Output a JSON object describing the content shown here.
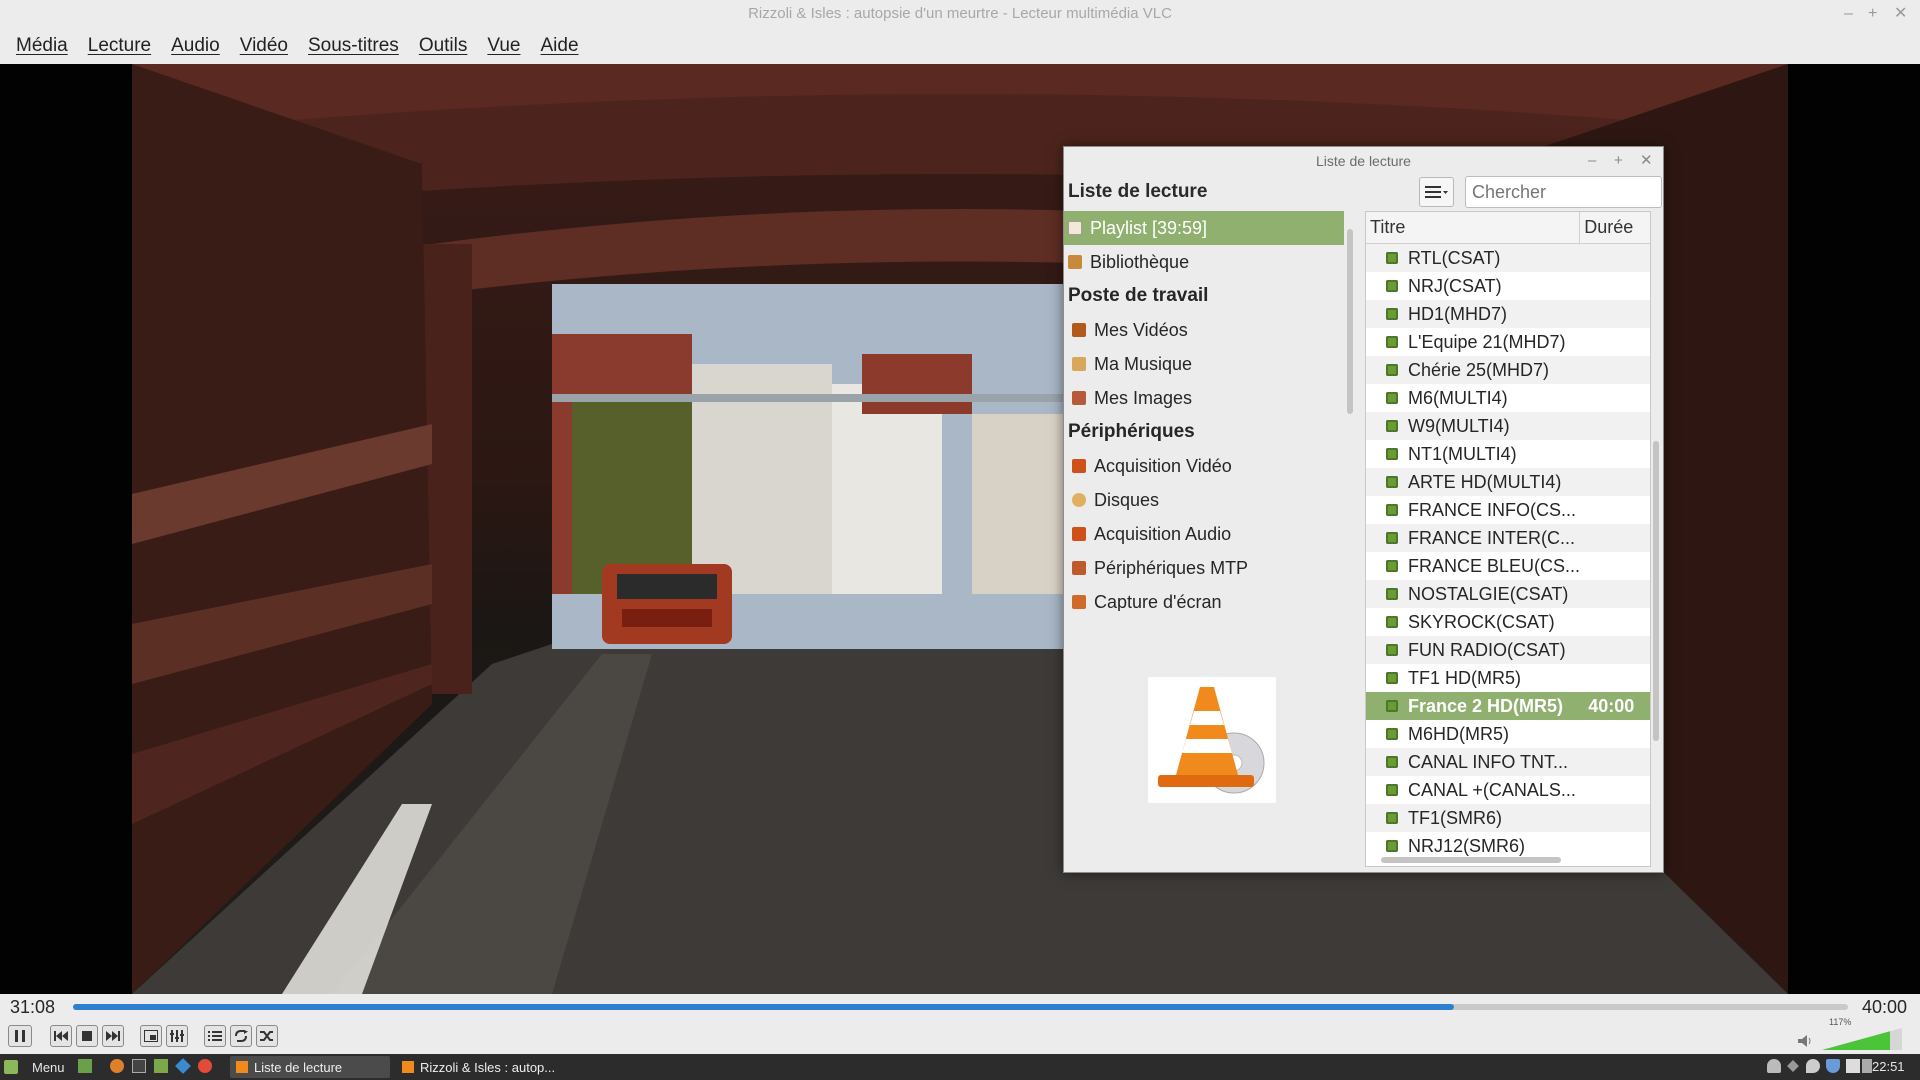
{
  "window": {
    "title": "Rizzoli & Isles : autopsie d'un meurtre - Lecteur multimédia VLC",
    "min_glyph": "–",
    "max_glyph": "+",
    "close_glyph": "✕"
  },
  "menu": [
    "Média",
    "Lecture",
    "Audio",
    "Vidéo",
    "Sous-titres",
    "Outils",
    "Vue",
    "Aide"
  ],
  "playlist_dialog": {
    "title": "Liste de lecture",
    "header": "Liste de lecture",
    "search_placeholder": "Chercher",
    "sidebar": {
      "playlist": "Playlist [39:59]",
      "library": "Bibliothèque",
      "cat_mycomputer": "Poste de travail",
      "my_videos": "Mes Vidéos",
      "my_music": "Ma Musique",
      "my_images": "Mes Images",
      "cat_devices": "Périphériques",
      "video_capture": "Acquisition Vidéo",
      "discs": "Disques",
      "audio_capture": "Acquisition Audio",
      "mtp_devices": "Périphériques MTP",
      "screen_capture": "Capture d'écran"
    },
    "columns": {
      "title": "Titre",
      "duration": "Durée"
    },
    "items": [
      {
        "title": "RTL(CSAT)",
        "duration": ""
      },
      {
        "title": "NRJ(CSAT)",
        "duration": ""
      },
      {
        "title": "HD1(MHD7)",
        "duration": ""
      },
      {
        "title": "L'Equipe 21(MHD7)",
        "duration": ""
      },
      {
        "title": "Chérie 25(MHD7)",
        "duration": ""
      },
      {
        "title": "M6(MULTI4)",
        "duration": ""
      },
      {
        "title": "W9(MULTI4)",
        "duration": ""
      },
      {
        "title": "NT1(MULTI4)",
        "duration": ""
      },
      {
        "title": "ARTE HD(MULTI4)",
        "duration": ""
      },
      {
        "title": "FRANCE INFO(CS...",
        "duration": ""
      },
      {
        "title": "FRANCE INTER(C...",
        "duration": ""
      },
      {
        "title": "FRANCE BLEU(CS...",
        "duration": ""
      },
      {
        "title": "NOSTALGIE(CSAT)",
        "duration": ""
      },
      {
        "title": "SKYROCK(CSAT)",
        "duration": ""
      },
      {
        "title": "FUN RADIO(CSAT)",
        "duration": ""
      },
      {
        "title": "TF1 HD(MR5)",
        "duration": ""
      },
      {
        "title": "France 2 HD(MR5)",
        "duration": "40:00"
      },
      {
        "title": "M6HD(MR5)",
        "duration": ""
      },
      {
        "title": "CANAL INFO TNT...",
        "duration": ""
      },
      {
        "title": "CANAL +(CANALS...",
        "duration": ""
      },
      {
        "title": "TF1(SMR6)",
        "duration": ""
      },
      {
        "title": "NRJ12(SMR6)",
        "duration": ""
      }
    ],
    "selected_index": 16
  },
  "playback": {
    "elapsed": "31:08",
    "total": "40:00",
    "progress_fraction": 0.778,
    "volume_label": "117%",
    "volume_fraction": 0.85
  },
  "taskbar": {
    "menu_label": "Menu",
    "tasks": [
      "Liste de lecture",
      "Rizzoli & Isles : autop..."
    ],
    "clock": "22:51"
  },
  "colors": {
    "selection": "#90b070",
    "progress": "#2f7fd0",
    "taskbar": "#2c2c2c"
  }
}
